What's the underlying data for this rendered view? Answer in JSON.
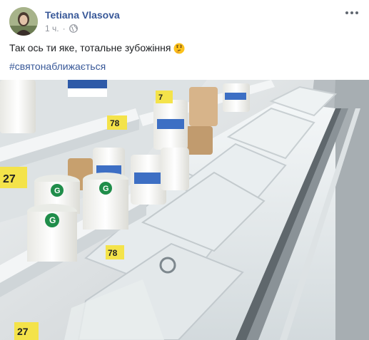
{
  "post": {
    "author": "Tetiana Vlasova",
    "time": "1 ч.",
    "separator": "·",
    "privacy_icon": "globe-icon",
    "menu_icon": "more-options-icon",
    "text": "Так ось ти яке, тотальне зубожіння",
    "emoji": "thinking-face-emoji",
    "hashtag": "#святонаближається"
  },
  "photo": {
    "price_tags": [
      "27",
      "78",
      "7",
      "78",
      "27"
    ]
  },
  "colors": {
    "link": "#385898",
    "meta": "#90949c",
    "text": "#1c1e21",
    "price_tag": "#f4e34a"
  }
}
